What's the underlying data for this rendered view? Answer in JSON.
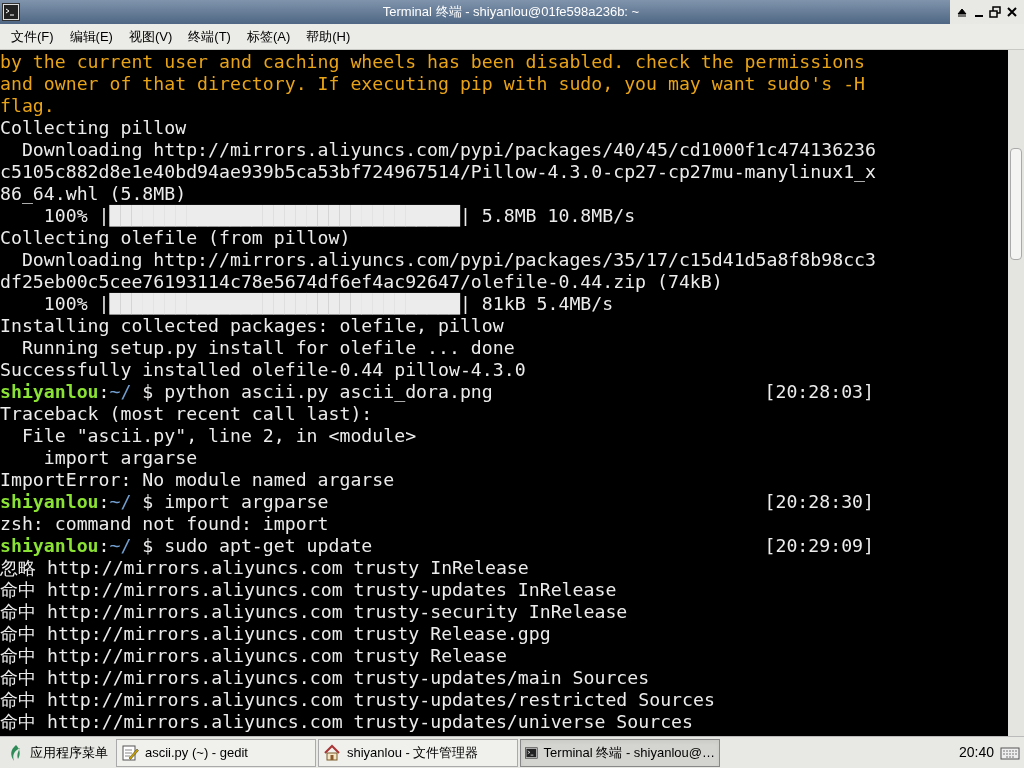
{
  "window": {
    "title": "Terminal 终端 - shiyanlou@01fe598a236b: ~"
  },
  "menu": [
    "文件(F)",
    "编辑(E)",
    "视图(V)",
    "终端(T)",
    "标签(A)",
    "帮助(H)"
  ],
  "terminal": {
    "lines": [
      {
        "kind": "warning",
        "text": "by the current user and caching wheels has been disabled. check the permissions"
      },
      {
        "kind": "warning",
        "text": "and owner of that directory. If executing pip with sudo, you may want sudo's -H"
      },
      {
        "kind": "warning",
        "text": "flag."
      },
      {
        "kind": "plain",
        "text": "Collecting pillow"
      },
      {
        "kind": "plain",
        "text": "  Downloading http://mirrors.aliyuncs.com/pypi/packages/40/45/cd1000f1c474136236"
      },
      {
        "kind": "plain",
        "text": "c5105c882d8e1e40bd94ae939b5ca53bf724967514/Pillow-4.3.0-cp27-cp27mu-manylinux1_x"
      },
      {
        "kind": "plain",
        "text": "86_64.whl (5.8MB)"
      },
      {
        "kind": "plain",
        "text": "    100% |████████████████████████████████| 5.8MB 10.8MB/s"
      },
      {
        "kind": "plain",
        "text": "Collecting olefile (from pillow)"
      },
      {
        "kind": "plain",
        "text": "  Downloading http://mirrors.aliyuncs.com/pypi/packages/35/17/c15d41d5a8f8b98cc3"
      },
      {
        "kind": "plain",
        "text": "df25eb00c5cee76193114c78e5674df6ef4ac92647/olefile-0.44.zip (74kB)"
      },
      {
        "kind": "plain",
        "text": "    100% |████████████████████████████████| 81kB 5.4MB/s"
      },
      {
        "kind": "plain",
        "text": "Installing collected packages: olefile, pillow"
      },
      {
        "kind": "plain",
        "text": "  Running setup.py install for olefile ... done"
      },
      {
        "kind": "plain",
        "text": "Successfully installed olefile-0.44 pillow-4.3.0"
      },
      {
        "kind": "prompt",
        "user": "shiyanlou",
        "sep": ":",
        "path": "~/",
        "command": " $ python ascii.py ascii_dora.png",
        "time": "[20:28:03]"
      },
      {
        "kind": "plain",
        "text": "Traceback (most recent call last):"
      },
      {
        "kind": "plain",
        "text": "  File \"ascii.py\", line 2, in <module>"
      },
      {
        "kind": "plain",
        "text": "    import argarse"
      },
      {
        "kind": "plain",
        "text": "ImportError: No module named argarse"
      },
      {
        "kind": "prompt",
        "user": "shiyanlou",
        "sep": ":",
        "path": "~/",
        "command": " $ import argparse",
        "time": "[20:28:30]"
      },
      {
        "kind": "plain",
        "text": "zsh: command not found: import"
      },
      {
        "kind": "prompt",
        "user": "shiyanlou",
        "sep": ":",
        "path": "~/",
        "command": " $ sudo apt-get update",
        "time": "[20:29:09]"
      },
      {
        "kind": "plain",
        "text": "忽略 http://mirrors.aliyuncs.com trusty InRelease"
      },
      {
        "kind": "plain",
        "text": "命中 http://mirrors.aliyuncs.com trusty-updates InRelease"
      },
      {
        "kind": "plain",
        "text": "命中 http://mirrors.aliyuncs.com trusty-security InRelease"
      },
      {
        "kind": "plain",
        "text": "命中 http://mirrors.aliyuncs.com trusty Release.gpg"
      },
      {
        "kind": "plain",
        "text": "命中 http://mirrors.aliyuncs.com trusty Release"
      },
      {
        "kind": "plain",
        "text": "命中 http://mirrors.aliyuncs.com trusty-updates/main Sources"
      },
      {
        "kind": "plain",
        "text": "命中 http://mirrors.aliyuncs.com trusty-updates/restricted Sources"
      },
      {
        "kind": "plain",
        "text": "命中 http://mirrors.aliyuncs.com trusty-updates/universe Sources"
      }
    ]
  },
  "taskbar": {
    "start": "应用程序菜单",
    "tasks": [
      {
        "kind": "editor",
        "label": "ascii.py (~) - gedit",
        "selected": false
      },
      {
        "kind": "files",
        "label": "shiyanlou - 文件管理器",
        "selected": false
      },
      {
        "kind": "terminal",
        "label": "Terminal 终端 - shiyanlou@…",
        "selected": true
      }
    ],
    "clock": "20:40"
  }
}
